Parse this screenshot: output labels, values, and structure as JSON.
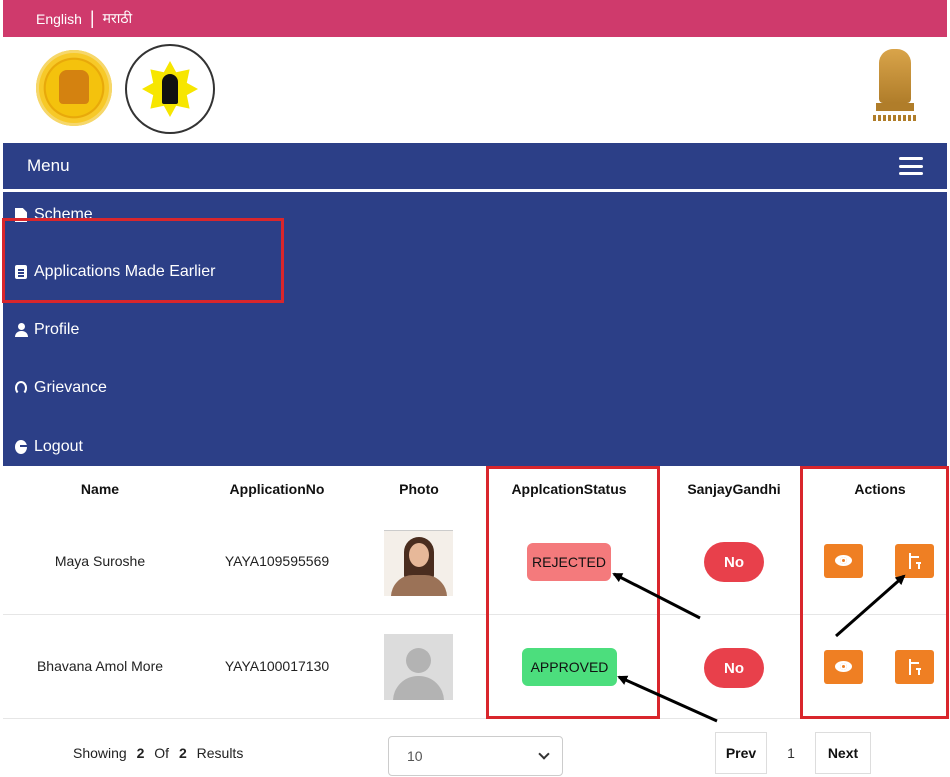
{
  "topbar": {
    "lang_en": "English",
    "separator": "|",
    "lang_mr": "मराठी"
  },
  "menubar": {
    "label": "Menu"
  },
  "nav": {
    "items": [
      {
        "label": "Scheme",
        "icon": "document-icon"
      },
      {
        "label": "Applications Made Earlier",
        "icon": "clipboard-icon"
      },
      {
        "label": "Profile",
        "icon": "user-icon"
      },
      {
        "label": "Grievance",
        "icon": "headset-icon"
      },
      {
        "label": "Logout",
        "icon": "logout-icon"
      }
    ]
  },
  "table": {
    "headers": [
      "Name",
      "ApplicationNo",
      "Photo",
      "ApplcationStatus",
      "SanjayGandhi",
      "Actions"
    ],
    "rows": [
      {
        "name": "Maya Suroshe",
        "application_no": "YAYA109595569",
        "status": "REJECTED",
        "sanjay_gandhi": "No"
      },
      {
        "name": "Bhavana Amol More",
        "application_no": "YAYA100017130",
        "status": "APPROVED",
        "sanjay_gandhi": "No"
      }
    ]
  },
  "footer": {
    "showing": "Showing",
    "count": "2",
    "of": "Of",
    "total": "2",
    "results": "Results",
    "page_size": "10",
    "prev_label": "Prev",
    "current_page": "1",
    "next_label": "Next"
  },
  "colors": {
    "topbar": "#cf3a6c",
    "nav": "#2c3f87",
    "rejected": "#f47a7c",
    "approved": "#4cde7d",
    "no_pill": "#e8404b",
    "action": "#ef7f23",
    "highlight": "#d9262c"
  }
}
